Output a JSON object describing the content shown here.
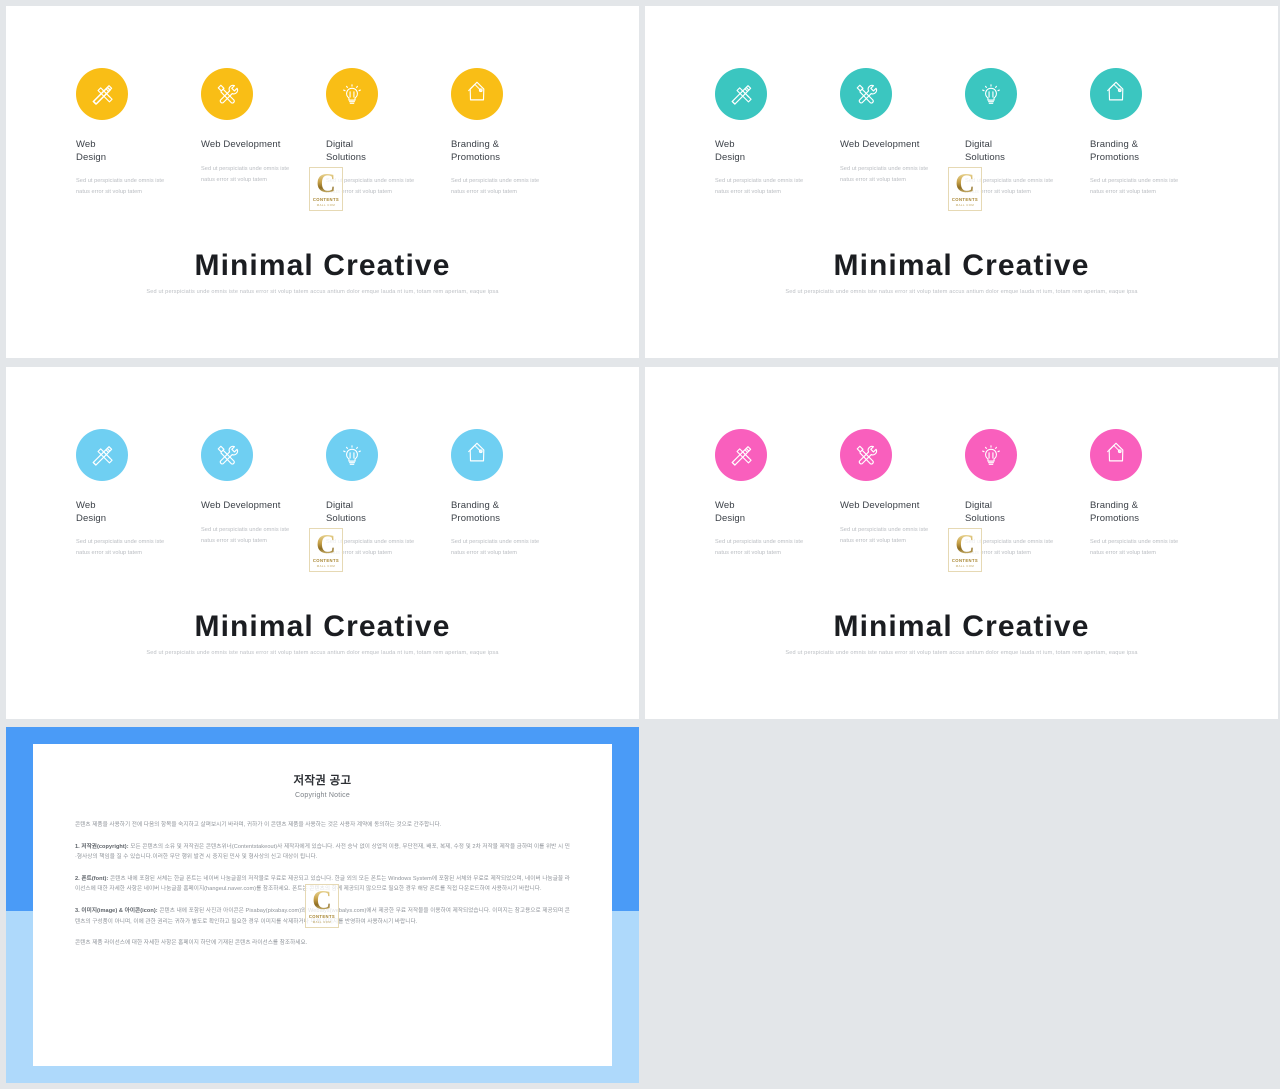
{
  "palette": {
    "page_bg": "#e3e6e9",
    "slide_bg": "#ffffff",
    "yellow": "#F9BE16",
    "teal": "#3BC6C0",
    "blue": "#6FCFF2",
    "pink": "#F95FBD",
    "frame_blue": "#4A9BF7",
    "frame_blue_light": "#AED9FB",
    "title_color": "#1b1d21",
    "body_color": "#b9bcc1"
  },
  "features": [
    {
      "icon": "pencil-ruler-icon",
      "title": "Web\nDesign",
      "body": "Sed ut perspiciatis unde omnis iste\nnatus error sit volup tatem"
    },
    {
      "icon": "screwdriver-wrench-icon",
      "title": "Web Development",
      "body": "Sed ut perspiciatis unde omnis iste\nnatus error sit volup tatem"
    },
    {
      "icon": "lightbulb-icon",
      "title": "Digital\nSolutions",
      "body": "Sed ut perspiciatis unde omnis iste\nnatus error sit volup tatem"
    },
    {
      "icon": "price-tags-icon",
      "title": "Branding &\nPromotions",
      "body": "Sed ut perspiciatis unde omnis iste\nnatus error sit volup tatem"
    }
  ],
  "headline": {
    "title": "Minimal Creative",
    "subtitle": "Sed ut perspiciatis unde omnis iste natus error sit volup tatem accus antium dolor emque lauda nt ium, totam rem aperiam, eaque ipsa"
  },
  "watermark": {
    "letter": "C",
    "brand": "CONTENTS",
    "tagline": "MALL  COM"
  },
  "slides": [
    {
      "name": "slide-yellow",
      "accent": "#F9BE16"
    },
    {
      "name": "slide-teal",
      "accent": "#3BC6C0"
    },
    {
      "name": "slide-blue",
      "accent": "#6FCFF2"
    },
    {
      "name": "slide-pink",
      "accent": "#F95FBD"
    }
  ],
  "copyright": {
    "title": "저작권 공고",
    "subtitle": "Copyright Notice",
    "intro": "콘텐츠 제품을 사용하기 전에 다음의 항목을 숙지하고 살펴보시기 바라며, 귀하가 이 콘텐츠 제품을 사용하는 것은 사용자 계약에 동의하는 것으로 간주합니다.",
    "sections": [
      {
        "label": "1. 저작권(copyright):",
        "text": " 모든 콘텐츠의 소유 및 저작권은 콘텐츠위너(Contentstakeout)사 제작자에게 있습니다. 사전 승낙 없이 상업적 이용, 무단전재, 배포, 복제, 수정 및 2차 저작물 제작을 금하며 이를 위반 시 민·형사상의 책임을 질 수 있습니다.",
        "text2": "이러한 무단 행위 발견 시 중지된 민사 및 형사상의 신고 대상이 됩니다."
      },
      {
        "label": "2. 폰트(font):",
        "text": " 콘텐츠 내에 포함된 서체는 한글 폰트는 네이버 나눔글꼴의 저작물로 무료로 제공되고 있습니다. 한글 외의 모든 폰트는 Windows System에 포함된 서체와 무료로 제작되었으며, 네이버 나눔글꼴 라이선스에 대한 자세한 사항은 네이버 나눔글꼴 홈페이지(hangeul.naver.com)를 참조하세요. 폰트는 콘텐츠의 함께 제공되지 않으므로 필요한 경우 해당 폰트를 직접 다운로드하여 사용하시기 바랍니다."
      },
      {
        "label": "3. 이미지(image) & 아이콘(icon):",
        "text": " 콘텐츠 내에 포함된 사진과 아이콘은 Pixabay(pixabay.com)와 Webalys(webalys.com)에서 제공한 무료 저작물을 이용하여 제작되었습니다. 이미지는 참고용으로 제공되며 콘텐츠의 구성품이 아니며, 이에 관한 권리는 귀하가 별도로 확인하고 필요한 경우 이미지를 삭제하거나 대체 이미지를 반영하여 사용하시기 바랍니다."
      }
    ],
    "footer": "콘텐츠 제품 라이선스에 대한 자세한 사항은 홈페이지 하단에 기재된 콘텐츠 라이선스를 참조하세요."
  }
}
